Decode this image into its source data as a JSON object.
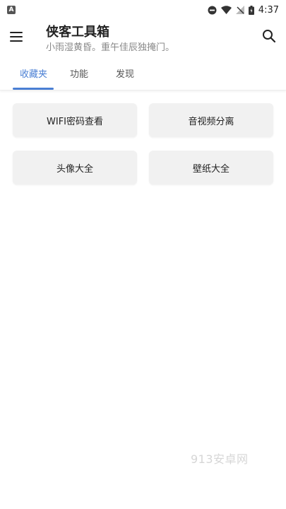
{
  "status_bar": {
    "left_icon": "A",
    "time": "4:37",
    "icons": [
      "dnd-icon",
      "wifi-icon",
      "no-signal-icon",
      "battery-icon"
    ]
  },
  "app_bar": {
    "title": "侠客工具箱",
    "subtitle": "小雨湿黄昏。重午佳辰独掩门。"
  },
  "tabs": [
    {
      "label": "收藏夹",
      "active": true
    },
    {
      "label": "功能",
      "active": false
    },
    {
      "label": "发现",
      "active": false
    }
  ],
  "cards": [
    {
      "label": "WIFI密码查看"
    },
    {
      "label": "音视频分离"
    },
    {
      "label": "头像大全"
    },
    {
      "label": "壁纸大全"
    }
  ],
  "watermark": "913安卓网",
  "colors": {
    "accent": "#4a7fd4",
    "card_bg": "#f1f1f1",
    "subtitle": "#888888"
  }
}
